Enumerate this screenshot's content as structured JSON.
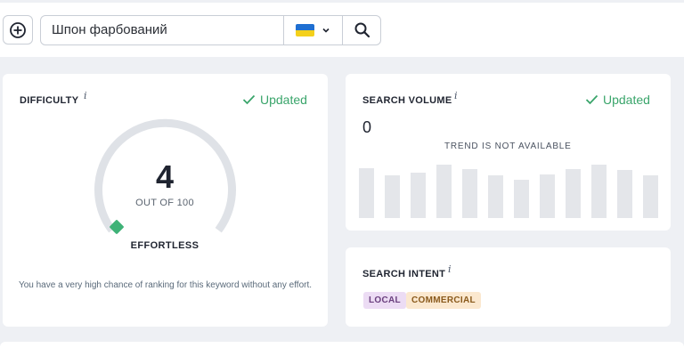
{
  "search": {
    "query": "Шпон фарбований",
    "country_flag": "ukraine-flag",
    "colors": {
      "blue": "#1f6fd1",
      "yellow": "#f4d01b"
    }
  },
  "difficulty": {
    "title": "DIFFICULTY",
    "info": "i",
    "status": "Updated",
    "value": "4",
    "value_of": "OUT OF 100",
    "level": "EFFORTLESS",
    "gauge_fraction": 0.04,
    "description": "You have a very high chance of ranking for this keyword without any effort."
  },
  "volume": {
    "title": "SEARCH VOLUME",
    "info": "i",
    "status": "Updated",
    "value": "0",
    "trend_text": "TREND IS NOT AVAILABLE",
    "trend_bars": [
      0.93,
      0.8,
      0.85,
      1.0,
      0.92,
      0.8,
      0.71,
      0.82,
      0.92,
      1.0,
      0.9,
      0.8
    ]
  },
  "intent": {
    "title": "SEARCH INTENT",
    "info": "i",
    "tags": [
      "LOCAL",
      "COMMERCIAL"
    ]
  },
  "colors": {
    "accent_green": "#3aa56b",
    "gauge_track": "#dfe2e7",
    "gauge_fill": "#3fb277"
  }
}
